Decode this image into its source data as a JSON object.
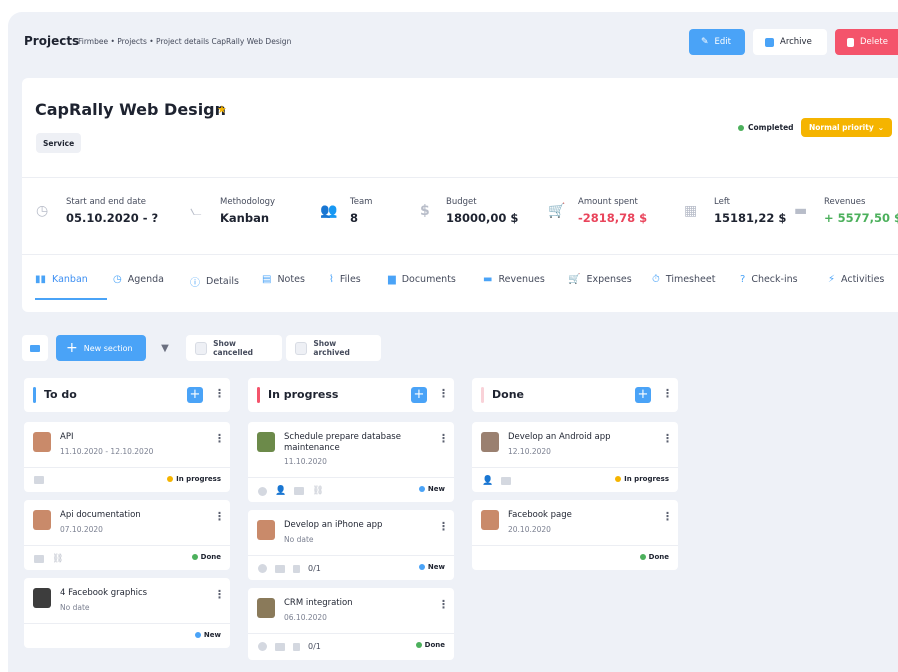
{
  "header": {
    "title": "Projects",
    "breadcrumbs": "Firmbee  •  Projects  •  Project details CapRally Web Design",
    "edit_label": "Edit",
    "archive_label": "Archive",
    "delete_label": "Delete"
  },
  "project": {
    "name": "CapRally Web Design",
    "tag": "Service",
    "status": "Completed",
    "priority": "Normal priority"
  },
  "stats": [
    {
      "label": "Start and end date",
      "value": "05.10.2020 - ?"
    },
    {
      "label": "Methodology",
      "value": "Kanban"
    },
    {
      "label": "Team",
      "value": "8"
    },
    {
      "label": "Budget",
      "value": "18000,00 $"
    },
    {
      "label": "Amount spent",
      "value": "-2818,78 $"
    },
    {
      "label": "Left",
      "value": "15181,22 $"
    },
    {
      "label": "Revenues",
      "value": "+ 5577,50 $"
    }
  ],
  "tabs": [
    "Kanban",
    "Agenda",
    "Details",
    "Notes",
    "Files",
    "Documents",
    "Revenues",
    "Expenses",
    "Timesheet",
    "Check-ins",
    "Activities"
  ],
  "toolbar": {
    "new_section": "New section",
    "show_cancelled": "Show cancelled",
    "show_archived": "Show archived"
  },
  "columns": [
    {
      "title": "To do",
      "tasks": [
        {
          "title": "API",
          "date": "11.10.2020 - 12.10.2020",
          "badge": "In progress"
        },
        {
          "title": "Api documentation",
          "date": "07.10.2020",
          "badge": "Done"
        },
        {
          "title": "4 Facebook graphics",
          "date": "No date",
          "badge": "New"
        }
      ]
    },
    {
      "title": "In progress",
      "tasks": [
        {
          "title": "Schedule prepare database maintenance",
          "date": "11.10.2020",
          "badge": "New"
        },
        {
          "title": "Develop an iPhone app",
          "date": "No date",
          "badge": "New",
          "count": "0/1"
        },
        {
          "title": "CRM integration",
          "date": "06.10.2020",
          "badge": "Done",
          "count": "0/1"
        }
      ]
    },
    {
      "title": "Done",
      "tasks": [
        {
          "title": "Develop an Android app",
          "date": "12.10.2020",
          "badge": "In progress"
        },
        {
          "title": "Facebook page",
          "date": "20.10.2020",
          "badge": "Done"
        }
      ]
    }
  ],
  "colors": {
    "accent": "#4aa3f7",
    "danger": "#f4546b",
    "warning": "#f5b400",
    "success": "#4cb05c",
    "todo_bar": "#4aa3f7",
    "inprogress_bar": "#f4546b",
    "done_bar": "#f9d2d8"
  }
}
